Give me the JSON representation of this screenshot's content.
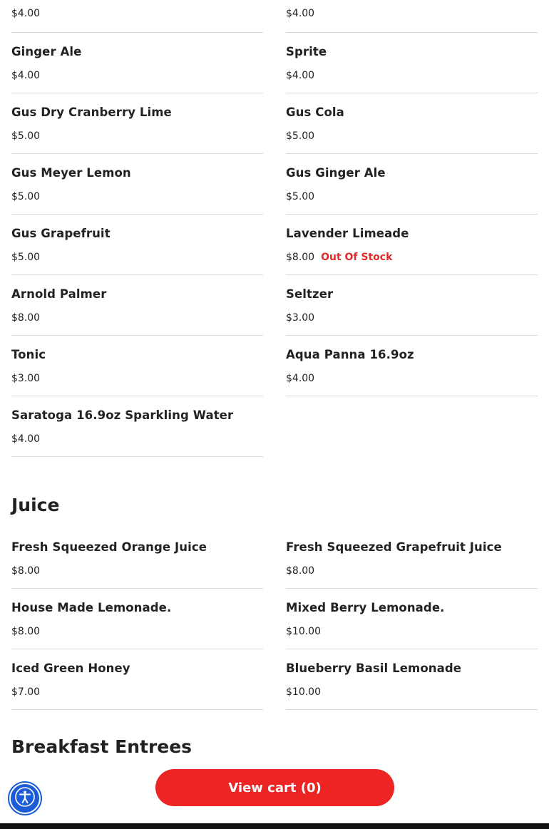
{
  "top_row": [
    "$4.00",
    "$4.00"
  ],
  "sodas": [
    {
      "name": "Ginger Ale",
      "price": "$4.00"
    },
    {
      "name": "Sprite",
      "price": "$4.00"
    },
    {
      "name": "Gus Dry Cranberry Lime",
      "price": "$5.00"
    },
    {
      "name": "Gus Cola",
      "price": "$5.00"
    },
    {
      "name": "Gus Meyer Lemon",
      "price": "$5.00"
    },
    {
      "name": "Gus Ginger Ale",
      "price": "$5.00"
    },
    {
      "name": "Gus Grapefruit",
      "price": "$5.00"
    },
    {
      "name": "Lavender Limeade",
      "price": "$8.00",
      "status": "Out Of Stock"
    },
    {
      "name": "Arnold Palmer",
      "price": "$8.00"
    },
    {
      "name": "Seltzer",
      "price": "$3.00"
    },
    {
      "name": "Tonic",
      "price": "$3.00"
    },
    {
      "name": "Aqua Panna 16.9oz",
      "price": "$4.00"
    },
    {
      "name": "Saratoga 16.9oz Sparkling Water",
      "price": "$4.00"
    }
  ],
  "juice": {
    "title": "Juice",
    "items": [
      {
        "name": "Fresh Squeezed Orange Juice",
        "price": "$8.00"
      },
      {
        "name": "Fresh Squeezed Grapefruit Juice",
        "price": "$8.00"
      },
      {
        "name": "House Made Lemonade.",
        "price": "$8.00"
      },
      {
        "name": "Mixed Berry Lemonade.",
        "price": "$10.00"
      },
      {
        "name": "Iced Green Honey",
        "price": "$7.00"
      },
      {
        "name": "Blueberry Basil Lemonade",
        "price": "$10.00"
      }
    ]
  },
  "breakfast": {
    "title": "Breakfast Entrees"
  },
  "cart": {
    "label": "View cart (0)"
  },
  "colors": {
    "accent": "#ec2424",
    "out_of_stock": "#e02b2b",
    "a11y": "#1c5cd6"
  },
  "icons": {
    "accessibility": "accessibility-icon"
  }
}
